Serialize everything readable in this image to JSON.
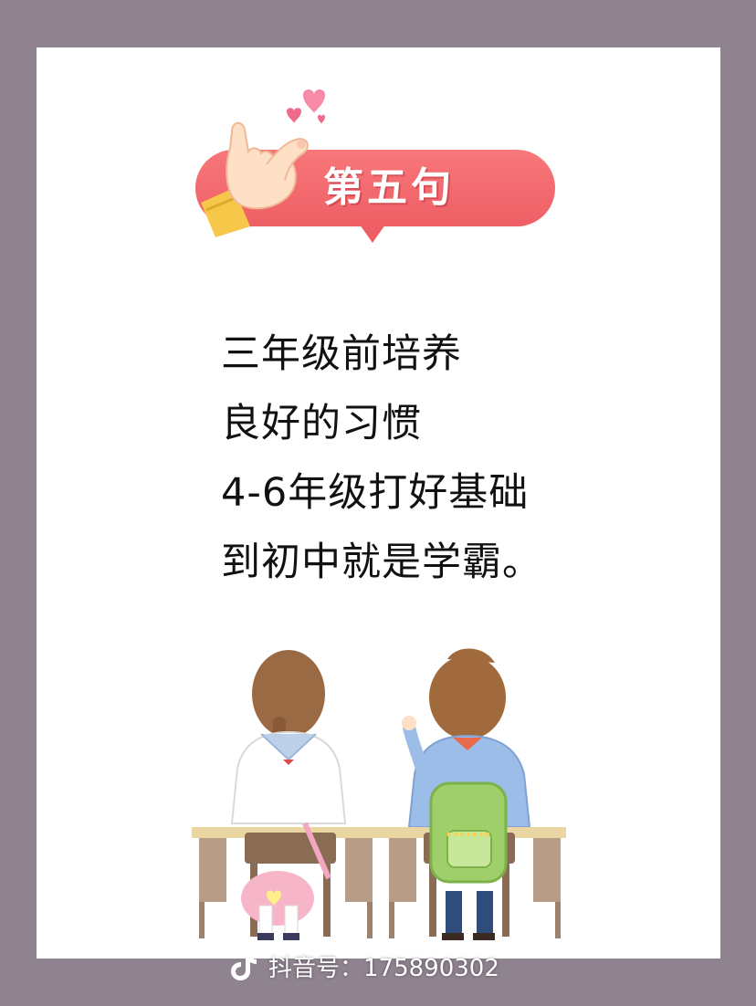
{
  "header": {
    "title": "第五句"
  },
  "lines": [
    "三年级前培养",
    "良好的习惯",
    "4-6年级打好基础",
    "到初中就是学霸。"
  ],
  "watermark": {
    "icon": "tiktok-icon",
    "text": "抖音号：175890302"
  },
  "colors": {
    "banner": "#ee5f65",
    "background": "#8f8390",
    "card": "#ffffff"
  }
}
